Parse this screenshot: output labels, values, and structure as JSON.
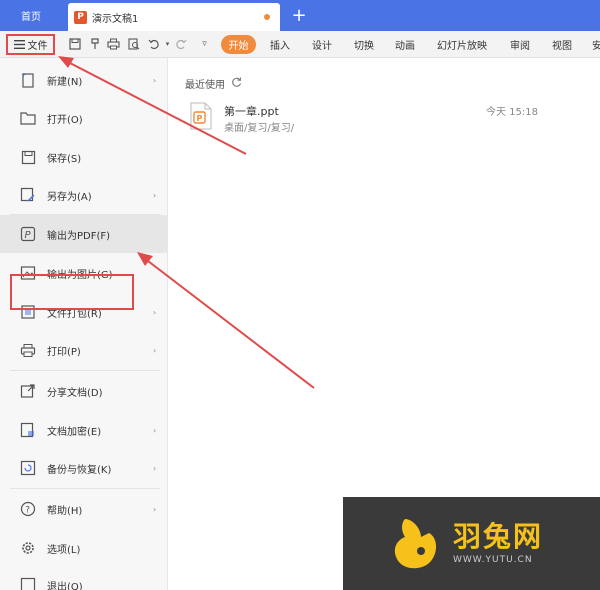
{
  "tabs": {
    "home_label": "首页",
    "doc_label": "演示文稿1",
    "doc_badge": "P",
    "new_tab": "+"
  },
  "toolbar": {
    "file_label": "文件",
    "start_label": "开始",
    "menus": [
      "插入",
      "设计",
      "切换",
      "动画",
      "幻灯片放映",
      "审阅",
      "视图",
      "安"
    ]
  },
  "file_menu": {
    "items": [
      {
        "label": "新建(N)",
        "icon": "new-file-icon",
        "submenu": true
      },
      {
        "label": "打开(O)",
        "icon": "folder-icon",
        "submenu": false
      },
      {
        "label": "保存(S)",
        "icon": "save-icon",
        "submenu": false
      },
      {
        "label": "另存为(A)",
        "icon": "save-as-icon",
        "submenu": true
      },
      {
        "label": "输出为PDF(F)",
        "icon": "pdf-icon",
        "submenu": false
      },
      {
        "label": "输出为图片(G)",
        "icon": "image-icon",
        "submenu": false
      },
      {
        "label": "文件打包(R)",
        "icon": "package-icon",
        "submenu": true
      },
      {
        "label": "打印(P)",
        "icon": "print-icon",
        "submenu": true
      },
      {
        "label": "分享文档(D)",
        "icon": "share-icon",
        "submenu": false
      },
      {
        "label": "文档加密(E)",
        "icon": "lock-doc-icon",
        "submenu": true
      },
      {
        "label": "备份与恢复(K)",
        "icon": "backup-icon",
        "submenu": true
      },
      {
        "label": "帮助(H)",
        "icon": "help-icon",
        "submenu": true
      },
      {
        "label": "选项(L)",
        "icon": "gear-icon",
        "submenu": false
      },
      {
        "label": "退出(Q)",
        "icon": "exit-icon",
        "submenu": false
      }
    ],
    "arrow_glyph": "›"
  },
  "recent": {
    "title": "最近使用",
    "files": [
      {
        "name": "第一章.ppt",
        "path": "桌面/复习/复习/",
        "time": "今天 15:18"
      }
    ]
  },
  "watermark": {
    "text": "羽兔网",
    "url": "WWW.YUTU.CN"
  },
  "colors": {
    "tab_bar": "#4a74e6",
    "accent_orange": "#f08a3c",
    "highlight_red": "#e04a4a",
    "watermark_yellow": "#f6c11b"
  }
}
